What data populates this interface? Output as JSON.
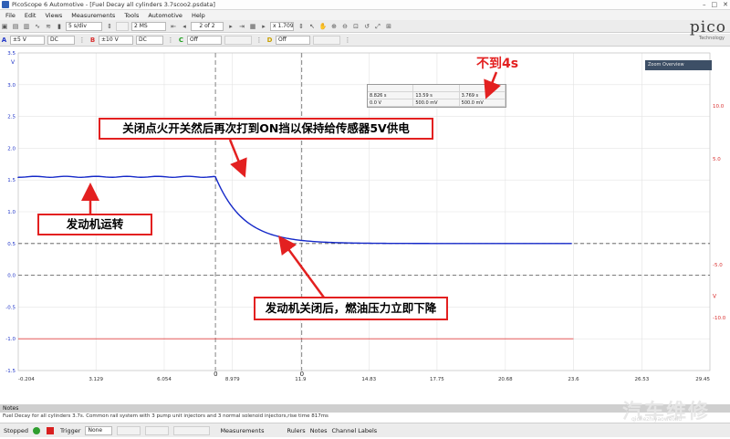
{
  "window": {
    "title": "PicoScope 6 Automotive - [Fuel Decay all cylinders 3.7scoo2.psdata]",
    "controls": [
      "–",
      "□",
      "✕"
    ]
  },
  "menu": [
    "File",
    "Edit",
    "Views",
    "Measurements",
    "Tools",
    "Automotive",
    "Help"
  ],
  "toolbar1": {
    "timebase": "5 s/div",
    "samples": "2 MS",
    "page": "2 of 2",
    "zoom": "x 1.709"
  },
  "toolbar2": {
    "chA_range": "±5 V",
    "chA_coupling": "DC",
    "chB_range": "±10 V",
    "chB_coupling": "DC",
    "chC_state": "Off",
    "chD_state": "Off"
  },
  "logo": {
    "text": "pico",
    "sub": "Technology"
  },
  "chart_data": {
    "type": "line",
    "x_ticks": [
      "-0.204",
      "3.129",
      "6.054",
      "8.979",
      "11.9",
      "14.83",
      "17.75",
      "20.68",
      "23.6",
      "26.53",
      "29.45"
    ],
    "xlim": [
      -0.204,
      29.45
    ],
    "left_axis": {
      "unit": "V",
      "ticks": [
        "3.5",
        "3.0",
        "2.5",
        "2.0",
        "1.5",
        "1.0",
        "0.5",
        "0.0",
        "-0.5",
        "-1.0",
        "-1.5"
      ],
      "ylim": [
        -1.5,
        3.5
      ],
      "color": "#2035c8"
    },
    "right_axis": {
      "unit": "V",
      "ticks": [
        "10.0",
        "5.0",
        "-5.0",
        "-10.0"
      ],
      "ylim": [
        -15,
        15
      ],
      "color": "#d93030"
    },
    "series": [
      {
        "name": "A",
        "color": "#1428c8",
        "plateau": 1.55,
        "drop_start": 8.25,
        "tau": 1.2,
        "floor": 0.5,
        "end": 23.6
      },
      {
        "name": "B",
        "color": "#e04040",
        "level": -1.0
      }
    ],
    "dashed_levels": [
      0.5,
      0.0
    ],
    "rulers_x": [
      8.25,
      11.95
    ],
    "ruler_label": "0"
  },
  "ruler_table": {
    "rows": [
      [
        "8.826 s",
        "13.59 s",
        "3.769 s"
      ],
      [
        "0.0 V",
        "500.0 mV",
        "500.0 mV"
      ]
    ]
  },
  "zoom_overview_label": "Zoom Overview",
  "annotations": {
    "top": "关闭点火开关然后再次打到ON挡以保持给传感器5V供电",
    "left": "发动机运转",
    "bottom": "发动机关闭后，燃油压力立即下降",
    "red": "不到4s"
  },
  "notes": {
    "header": "Notes",
    "body": "Fuel Decay for all cylinders 3.7s. Common rail system with 3 pump unit injectors and 3 normal solenoid injectors,rise time 817ms"
  },
  "status": {
    "state": "Stopped",
    "trigger_label": "Trigger",
    "trigger_value": "None",
    "measurements": "Measurements",
    "rulers": "Rulers",
    "notes": "Notes",
    "channel_labels": "Channel Labels"
  },
  "watermark": {
    "text": "汽车维修",
    "sub": "qichezhiyaoweixiu"
  }
}
